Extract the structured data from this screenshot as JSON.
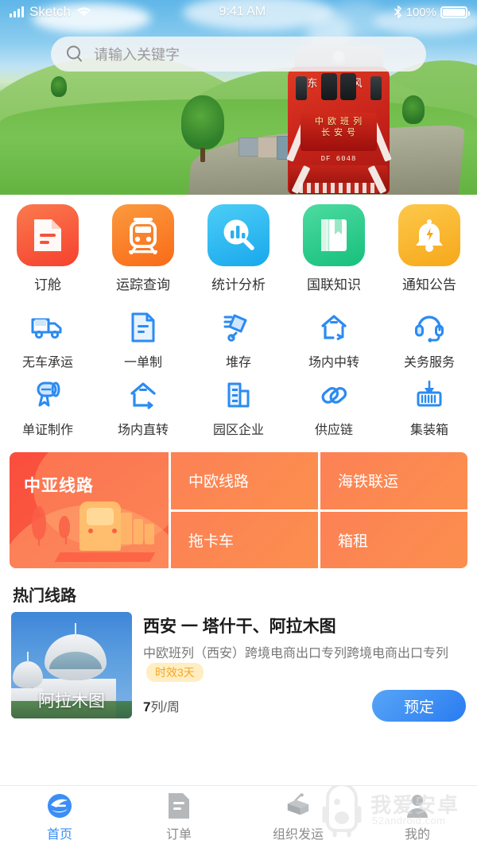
{
  "status_bar": {
    "carrier": "Sketch",
    "time": "9:41 AM",
    "battery_pct": "100%",
    "wifi_icon": "wifi-icon",
    "bluetooth_icon": "bluetooth-icon",
    "signal_icon": "signal-bars-icon"
  },
  "search": {
    "placeholder": "请输入关键字",
    "icon": "search-icon"
  },
  "hero": {
    "train_name_line1": "中 欧 班 列",
    "train_name_line2": "长 安 号",
    "train_number": "DF 6048",
    "top_left_char": "东",
    "top_right_char": "风"
  },
  "primary_actions": [
    {
      "label": "订舱",
      "icon": "document-icon",
      "color": "#f9553a"
    },
    {
      "label": "运踪查询",
      "icon": "train-front-icon",
      "color": "#fb7a28"
    },
    {
      "label": "统计分析",
      "icon": "chart-search-icon",
      "color": "#29b6f2"
    },
    {
      "label": "国联知识",
      "icon": "book-icon",
      "color": "#27c98a"
    },
    {
      "label": "通知公告",
      "icon": "bell-bolt-icon",
      "color": "#f9b229"
    }
  ],
  "secondary_actions_row1": [
    {
      "label": "无车承运",
      "icon": "truck-icon"
    },
    {
      "label": "一单制",
      "icon": "single-document-icon"
    },
    {
      "label": "堆存",
      "icon": "hand-truck-icon"
    },
    {
      "label": "场内中转",
      "icon": "yard-transfer-icon"
    },
    {
      "label": "关务服务",
      "icon": "headset-icon"
    }
  ],
  "secondary_actions_row2": [
    {
      "label": "单证制作",
      "icon": "certificate-icon"
    },
    {
      "label": "场内直转",
      "icon": "yard-direct-icon"
    },
    {
      "label": "园区企业",
      "icon": "building-icon"
    },
    {
      "label": "供应链",
      "icon": "chain-link-icon"
    },
    {
      "label": "集装箱",
      "icon": "container-icon"
    }
  ],
  "routes_panel": {
    "featured": {
      "label": "中亚线路",
      "accent": "#fb4d3d"
    },
    "cells": [
      {
        "label": "中欧线路"
      },
      {
        "label": "海铁联运"
      },
      {
        "label": "拖卡车"
      },
      {
        "label": "箱租"
      }
    ]
  },
  "hot_routes": {
    "section_title": "热门线路",
    "item": {
      "thumb_caption": "阿拉木图",
      "title": "西安 一 塔什干、阿拉木图",
      "description": "中欧班列（西安）跨境电商出口专列跨境电商出口专列",
      "badge": "时效3天",
      "frequency_value": "7",
      "frequency_unit": "列/周",
      "book_label": "预定"
    }
  },
  "tabbar": [
    {
      "label": "首页",
      "icon": "home-logo-icon",
      "active": true
    },
    {
      "label": "订单",
      "icon": "order-document-icon",
      "active": false
    },
    {
      "label": "组织发运",
      "icon": "crane-container-icon",
      "active": false
    },
    {
      "label": "我的",
      "icon": "profile-icon",
      "active": false
    }
  ],
  "watermark": {
    "title": "我爱安卓",
    "url": "52android.com",
    "icon": "android-mascot-icon"
  },
  "colors": {
    "primary_blue": "#3a8ef6",
    "accent_orange": "#fb7a28",
    "badge_text": "#f5a623",
    "badge_bg": "#ffeec2"
  }
}
